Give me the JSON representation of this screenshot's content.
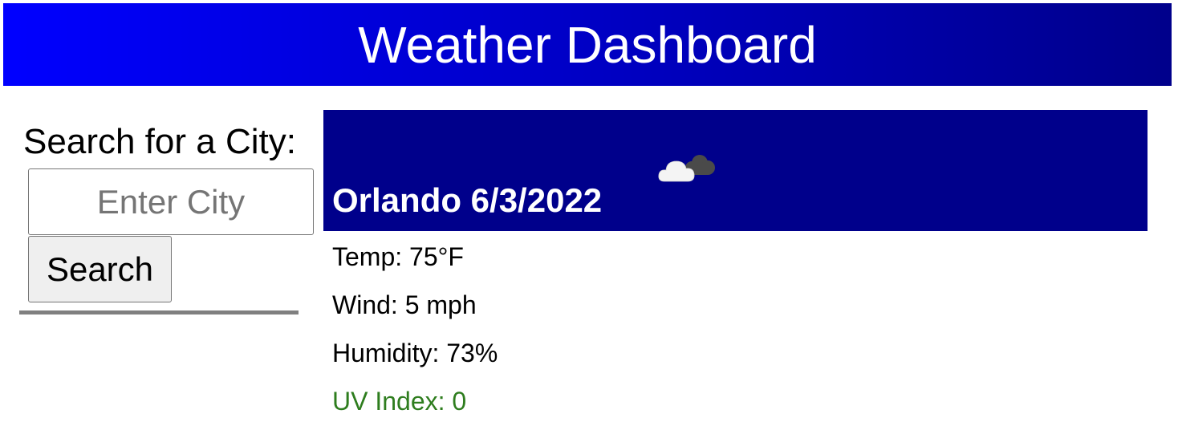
{
  "header": {
    "title": "Weather Dashboard"
  },
  "sidebar": {
    "heading": "Search for a City:",
    "input": {
      "placeholder": "Enter City",
      "value": ""
    },
    "search_button_label": "Search"
  },
  "current": {
    "title": "Orlando 6/3/2022",
    "icon": "cloudy-icon",
    "temp": "Temp: 75°F",
    "wind": "Wind: 5 mph",
    "humidity": "Humidity: 73%",
    "uv_index": "UV Index: 0"
  },
  "colors": {
    "header_gradient_start": "#0000ff",
    "header_gradient_end": "#00008b",
    "card_background": "#00008b",
    "uv_favorable": "#2e7d1e",
    "divider": "#808080"
  }
}
